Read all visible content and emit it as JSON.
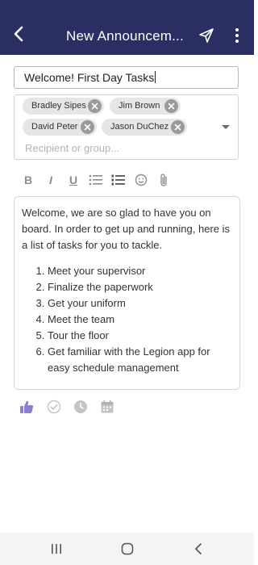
{
  "header": {
    "title": "New Announcem...",
    "back_icon": "back-arrow-icon",
    "send_icon": "send-icon",
    "more_icon": "more-vertical-icon",
    "background_color": "#2a2e63"
  },
  "subject": {
    "value": "Welcome! First Day Tasks"
  },
  "recipients": {
    "chips": [
      {
        "label": "Bradley Sipes"
      },
      {
        "label": "Jim Brown"
      },
      {
        "label": "David Peter"
      },
      {
        "label": "Jason DuChez"
      }
    ],
    "placeholder": "Recipient or group..."
  },
  "editor_toolbar": {
    "bold": "B",
    "italic": "I",
    "underline": "U",
    "icons": [
      "bullet-list-icon",
      "numbered-list-icon",
      "emoji-icon",
      "attachment-icon"
    ]
  },
  "message": {
    "intro": "Welcome, we are so glad to have you on board. In order to get up and running, here is a list of tasks for you to tackle.",
    "tasks": [
      "Meet your supervisor",
      "Finalize the paperwork",
      "Get your uniform",
      "Meet the team",
      "Tour the floor",
      "Get familiar with the Legion app for easy schedule management"
    ]
  },
  "response_options": {
    "icons": [
      "thumbs-up-icon",
      "check-circle-icon",
      "clock-icon",
      "calendar-icon"
    ],
    "active_color": "#8b7fd0",
    "inactive_color": "#c4c4c4"
  },
  "system_nav": {
    "icons": [
      "recent-apps-icon",
      "home-icon",
      "back-icon"
    ]
  }
}
